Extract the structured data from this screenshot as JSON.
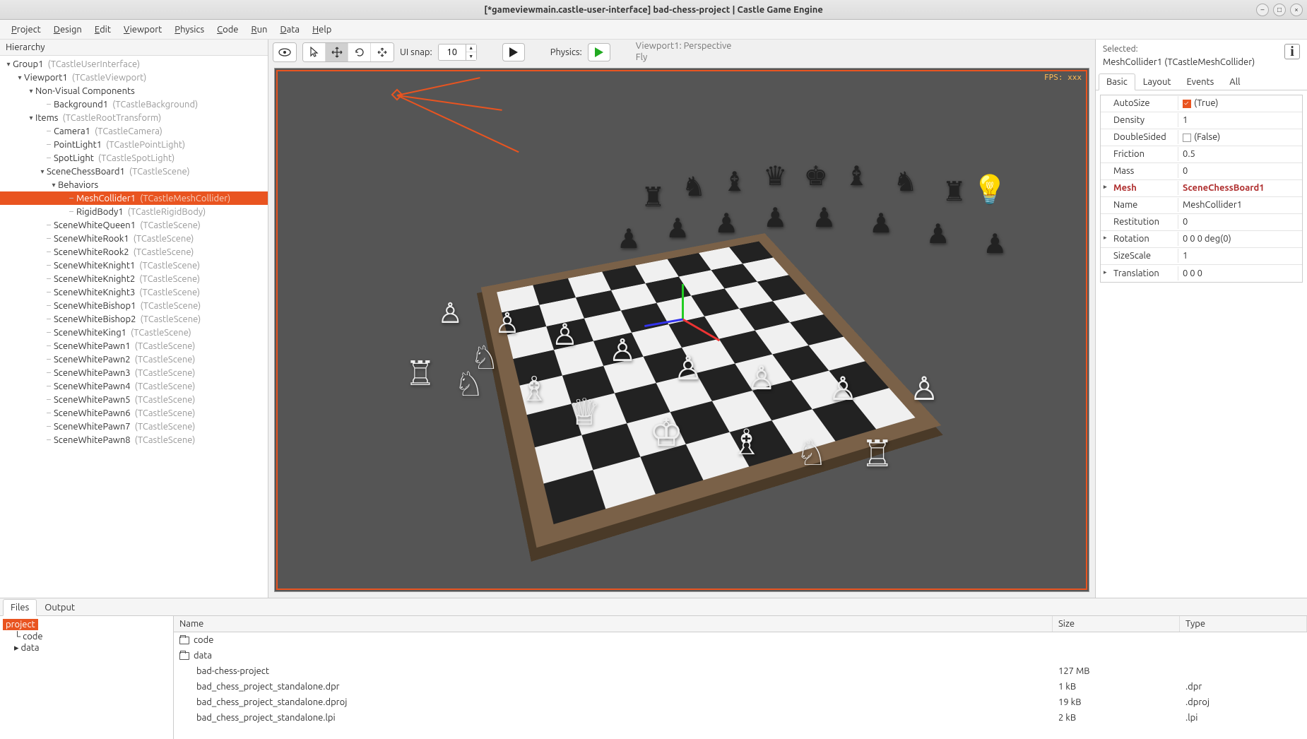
{
  "window": {
    "title": "[*gameviewmain.castle-user-interface] bad-chess-project | Castle Game Engine"
  },
  "menu": [
    "Project",
    "Design",
    "Edit",
    "Viewport",
    "Physics",
    "Code",
    "Run",
    "Data",
    "Help"
  ],
  "hierarchy": {
    "title": "Hierarchy",
    "nodes": [
      {
        "depth": 0,
        "arrow": "▾",
        "name": "Group1",
        "type": "(TCastleUserInterface)"
      },
      {
        "depth": 1,
        "arrow": "▾",
        "name": "Viewport1",
        "type": "(TCastleViewport)"
      },
      {
        "depth": 2,
        "arrow": "▾",
        "name": "Non-Visual Components",
        "type": ""
      },
      {
        "depth": 3,
        "arrow": "",
        "name": "Background1",
        "type": "(TCastleBackground)"
      },
      {
        "depth": 2,
        "arrow": "▾",
        "name": "Items",
        "type": "(TCastleRootTransform)"
      },
      {
        "depth": 3,
        "arrow": "",
        "name": "Camera1",
        "type": "(TCastleCamera)"
      },
      {
        "depth": 3,
        "arrow": "",
        "name": "PointLight1",
        "type": "(TCastlePointLight)"
      },
      {
        "depth": 3,
        "arrow": "",
        "name": "SpotLight",
        "type": "(TCastleSpotLight)"
      },
      {
        "depth": 3,
        "arrow": "▾",
        "name": "SceneChessBoard1",
        "type": "(TCastleScene)"
      },
      {
        "depth": 4,
        "arrow": "▾",
        "name": "Behaviors",
        "type": ""
      },
      {
        "depth": 5,
        "arrow": "",
        "name": "MeshCollider1",
        "type": "(TCastleMeshCollider)",
        "selected": true
      },
      {
        "depth": 5,
        "arrow": "",
        "name": "RigidBody1",
        "type": "(TCastleRigidBody)"
      },
      {
        "depth": 3,
        "arrow": "",
        "name": "SceneWhiteQueen1",
        "type": "(TCastleScene)"
      },
      {
        "depth": 3,
        "arrow": "",
        "name": "SceneWhiteRook1",
        "type": "(TCastleScene)"
      },
      {
        "depth": 3,
        "arrow": "",
        "name": "SceneWhiteRook2",
        "type": "(TCastleScene)"
      },
      {
        "depth": 3,
        "arrow": "",
        "name": "SceneWhiteKnight1",
        "type": "(TCastleScene)"
      },
      {
        "depth": 3,
        "arrow": "",
        "name": "SceneWhiteKnight2",
        "type": "(TCastleScene)"
      },
      {
        "depth": 3,
        "arrow": "",
        "name": "SceneWhiteKnight3",
        "type": "(TCastleScene)"
      },
      {
        "depth": 3,
        "arrow": "",
        "name": "SceneWhiteBishop1",
        "type": "(TCastleScene)"
      },
      {
        "depth": 3,
        "arrow": "",
        "name": "SceneWhiteBishop2",
        "type": "(TCastleScene)"
      },
      {
        "depth": 3,
        "arrow": "",
        "name": "SceneWhiteKing1",
        "type": "(TCastleScene)"
      },
      {
        "depth": 3,
        "arrow": "",
        "name": "SceneWhitePawn1",
        "type": "(TCastleScene)"
      },
      {
        "depth": 3,
        "arrow": "",
        "name": "SceneWhitePawn2",
        "type": "(TCastleScene)"
      },
      {
        "depth": 3,
        "arrow": "",
        "name": "SceneWhitePawn3",
        "type": "(TCastleScene)"
      },
      {
        "depth": 3,
        "arrow": "",
        "name": "SceneWhitePawn4",
        "type": "(TCastleScene)"
      },
      {
        "depth": 3,
        "arrow": "",
        "name": "SceneWhitePawn5",
        "type": "(TCastleScene)"
      },
      {
        "depth": 3,
        "arrow": "",
        "name": "SceneWhitePawn6",
        "type": "(TCastleScene)"
      },
      {
        "depth": 3,
        "arrow": "",
        "name": "SceneWhitePawn7",
        "type": "(TCastleScene)"
      },
      {
        "depth": 3,
        "arrow": "",
        "name": "SceneWhitePawn8",
        "type": "(TCastleScene)"
      }
    ]
  },
  "toolbar": {
    "ui_snap_label": "UI snap:",
    "ui_snap_value": "10",
    "physics_label": "Physics:",
    "viewport_info_1": "Viewport1: Perspective",
    "viewport_info_2": "Fly"
  },
  "viewport": {
    "fps_label": "FPS: xxx"
  },
  "inspector": {
    "selected_label": "Selected:",
    "selected_name": "MeshCollider1 (TCastleMeshCollider)",
    "tabs": [
      "Basic",
      "Layout",
      "Events",
      "All"
    ],
    "active_tab": 0,
    "props": [
      {
        "k": "AutoSize",
        "v": "(True)",
        "check": true
      },
      {
        "k": "Density",
        "v": "1"
      },
      {
        "k": "DoubleSided",
        "v": "(False)",
        "check": false
      },
      {
        "k": "Friction",
        "v": "0.5"
      },
      {
        "k": "Mass",
        "v": "0"
      },
      {
        "k": "Mesh",
        "v": "SceneChessBoard1",
        "hl": true,
        "exp": "▸"
      },
      {
        "k": "Name",
        "v": "MeshCollider1"
      },
      {
        "k": "Restitution",
        "v": "0"
      },
      {
        "k": "Rotation",
        "v": "0 0 0 deg(0)",
        "exp": "▸"
      },
      {
        "k": "SizeScale",
        "v": "1"
      },
      {
        "k": "Translation",
        "v": "0 0 0",
        "exp": "▸"
      }
    ]
  },
  "bottom": {
    "tabs": [
      "Files",
      "Output"
    ],
    "active_tab": 0,
    "dirtree": [
      {
        "name": "project",
        "sel": true,
        "depth": 0
      },
      {
        "name": "code",
        "depth": 1,
        "tick": true
      },
      {
        "name": "data",
        "depth": 1,
        "arrow": "▸"
      }
    ],
    "columns": [
      "Name",
      "Size",
      "Type"
    ],
    "files": [
      {
        "name": "code",
        "folder": true
      },
      {
        "name": "data",
        "folder": true
      },
      {
        "name": "bad-chess-project",
        "size": "127 MB",
        "type": ""
      },
      {
        "name": "bad_chess_project_standalone.dpr",
        "size": "1 kB",
        "type": ".dpr"
      },
      {
        "name": "bad_chess_project_standalone.dproj",
        "size": "19 kB",
        "type": ".dproj"
      },
      {
        "name": "bad_chess_project_standalone.lpi",
        "size": "2 kB",
        "type": ".lpi"
      }
    ]
  }
}
